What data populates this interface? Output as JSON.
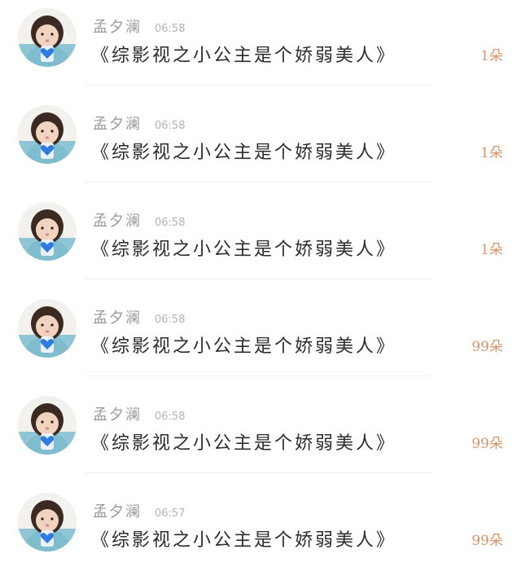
{
  "messages": [
    {
      "name": "孟夕澜",
      "time": "06:58",
      "text": "《综影视之小公主是个娇弱美人》",
      "gift": "1朵"
    },
    {
      "name": "孟夕澜",
      "time": "06:58",
      "text": "《综影视之小公主是个娇弱美人》",
      "gift": "1朵"
    },
    {
      "name": "孟夕澜",
      "time": "06:58",
      "text": "《综影视之小公主是个娇弱美人》",
      "gift": "1朵"
    },
    {
      "name": "孟夕澜",
      "time": "06:58",
      "text": "《综影视之小公主是个娇弱美人》",
      "gift": "99朵"
    },
    {
      "name": "孟夕澜",
      "time": "06:58",
      "text": "《综影视之小公主是个娇弱美人》",
      "gift": "99朵"
    },
    {
      "name": "孟夕澜",
      "time": "06:57",
      "text": "《综影视之小公主是个娇弱美人》",
      "gift": "99朵"
    }
  ],
  "colors": {
    "gift": "#d9956a",
    "name": "#9a9a9a",
    "time": "#b3b3b3",
    "text": "#2c2c2c",
    "heart": "#2f7be0"
  },
  "icons": {
    "avatar": "avatar-girl-holding-heart-icon"
  }
}
